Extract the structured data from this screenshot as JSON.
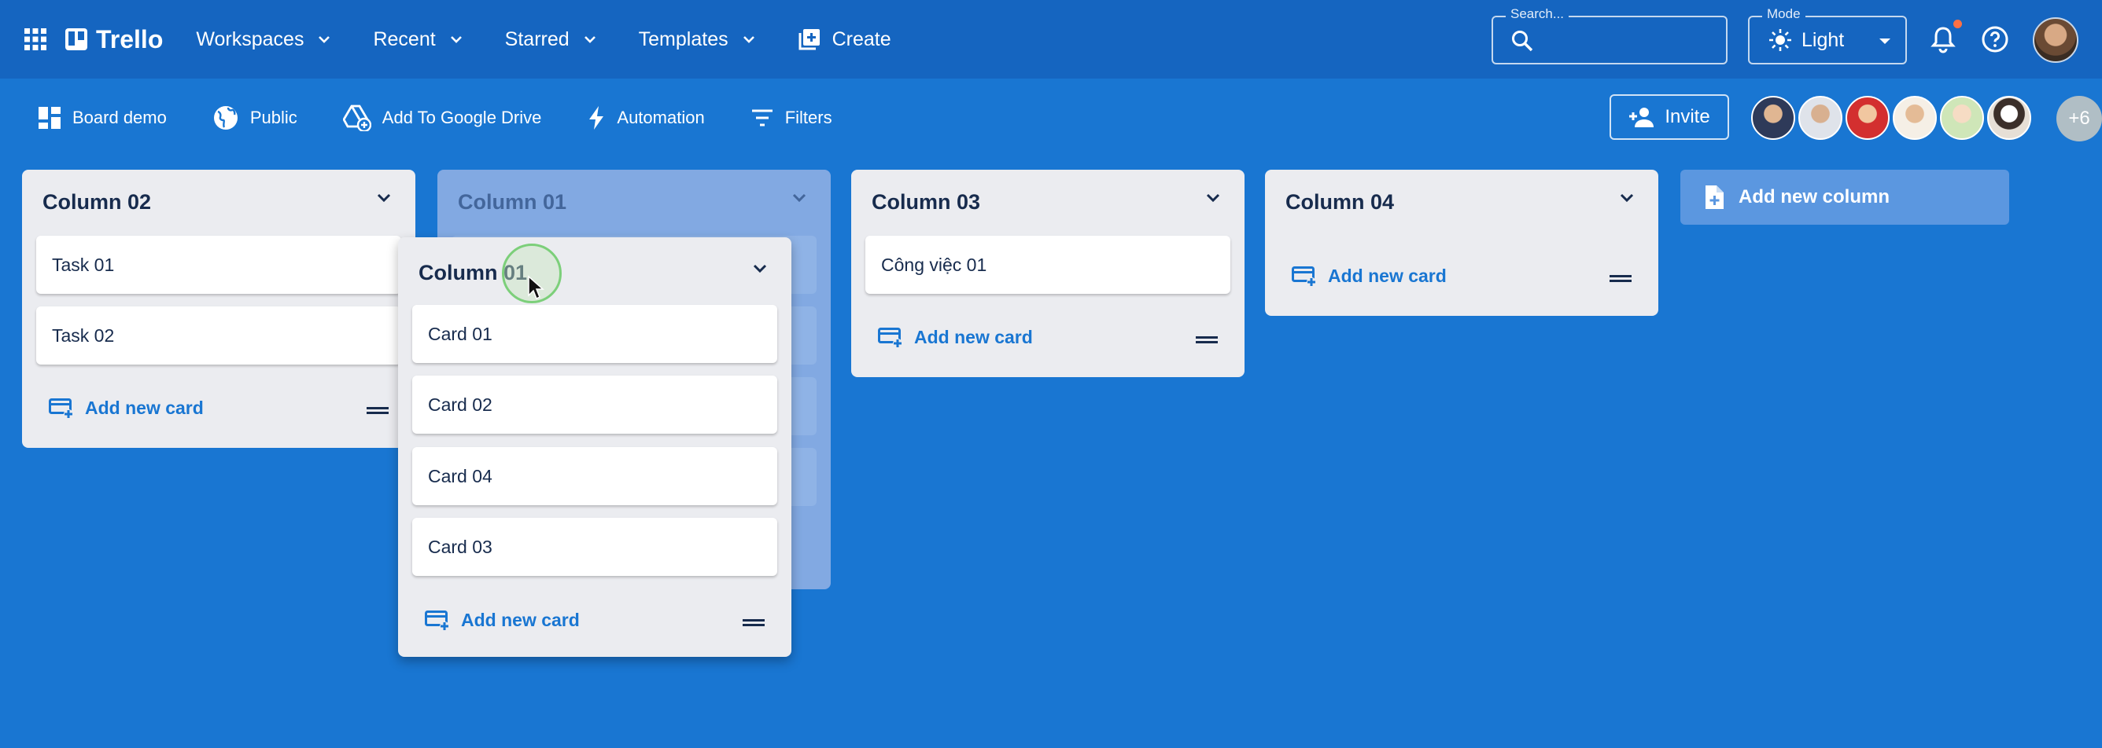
{
  "appbar": {
    "app_name": "Trello",
    "menus": [
      "Workspaces",
      "Recent",
      "Starred",
      "Templates"
    ],
    "create_label": "Create",
    "search": {
      "label": "Search...",
      "value": ""
    },
    "mode": {
      "label": "Mode",
      "value": "Light"
    }
  },
  "boardbar": {
    "board_name": "Board demo",
    "visibility": "Public",
    "drive_label": "Add To Google Drive",
    "automation_label": "Automation",
    "filters_label": "Filters",
    "invite_label": "Invite",
    "members_more": "+6"
  },
  "columns": [
    {
      "title": "Column 02",
      "cards": [
        "Task 01",
        "Task 02"
      ],
      "add_label": "Add new card"
    },
    {
      "title": "Column 01",
      "ghost": true
    },
    {
      "title": "Column 03",
      "cards": [
        "Công việc 01"
      ],
      "add_label": "Add new card"
    },
    {
      "title": "Column 04",
      "cards": [],
      "add_label": "Add new card"
    }
  ],
  "dragging_column": {
    "title": "Column 01",
    "cards": [
      "Card 01",
      "Card 02",
      "Card 04",
      "Card 03"
    ],
    "add_label": "Add new card"
  },
  "add_column_label": "Add new column",
  "colors": {
    "appbar": "#1565c0",
    "board_bg": "#1976d2",
    "column_bg": "#ebecf0",
    "accent": "#1976d2",
    "notification_dot": "#ff7043"
  }
}
